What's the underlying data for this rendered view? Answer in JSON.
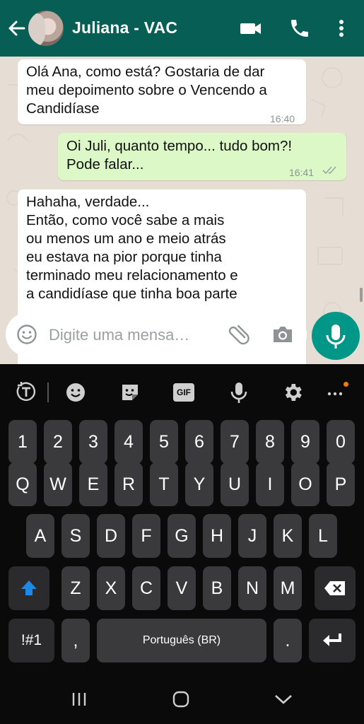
{
  "header": {
    "contact_name": "Juliana - VAC",
    "icons": [
      "back-arrow-icon",
      "video-call-icon",
      "voice-call-icon",
      "more-vert-icon"
    ]
  },
  "messages": [
    {
      "direction": "incoming",
      "lines": [
        "Olá Ana, como está? Gostaria de dar",
        "meu depoimento sobre o Vencendo a",
        "Candidíase"
      ],
      "time": "16:40"
    },
    {
      "direction": "outgoing",
      "lines": [
        "Oi Juli, quanto tempo... tudo bom?!",
        "Pode falar..."
      ],
      "time": "16:41",
      "status": "read"
    },
    {
      "direction": "incoming",
      "lines": [
        "Hahaha, verdade...",
        "Então, como você sabe a mais",
        "ou menos um ano e meio atrás",
        "eu estava na pior porque tinha",
        "terminado meu relacionamento e",
        "a candidíase que tinha boa parte"
      ],
      "time": ""
    }
  ],
  "composer": {
    "placeholder": "Digite uma mensa…"
  },
  "keyboard": {
    "toolbar": [
      "text-mode-icon",
      "emoji-icon",
      "sticker-icon",
      "gif-icon",
      "mic-icon",
      "settings-icon",
      "more-icon"
    ],
    "toolbar_gif_label": "GIF",
    "row_numbers": [
      "1",
      "2",
      "3",
      "4",
      "5",
      "6",
      "7",
      "8",
      "9",
      "0"
    ],
    "row_1": [
      "Q",
      "W",
      "E",
      "R",
      "T",
      "Y",
      "U",
      "I",
      "O",
      "P"
    ],
    "row_2": [
      "A",
      "S",
      "D",
      "F",
      "G",
      "H",
      "J",
      "K",
      "L"
    ],
    "row_3": [
      "Z",
      "X",
      "C",
      "V",
      "B",
      "N",
      "M"
    ],
    "symbols_label": "!#1",
    "comma_label": ",",
    "space_label": "Português (BR)",
    "period_label": ".",
    "accent_color": "#1e88e5"
  },
  "colors": {
    "header": "#075e54",
    "fab": "#009688",
    "outgoing_bubble": "#dcf8c6",
    "incoming_bubble": "#ffffff",
    "read_ticks": "#9aa7a0"
  }
}
